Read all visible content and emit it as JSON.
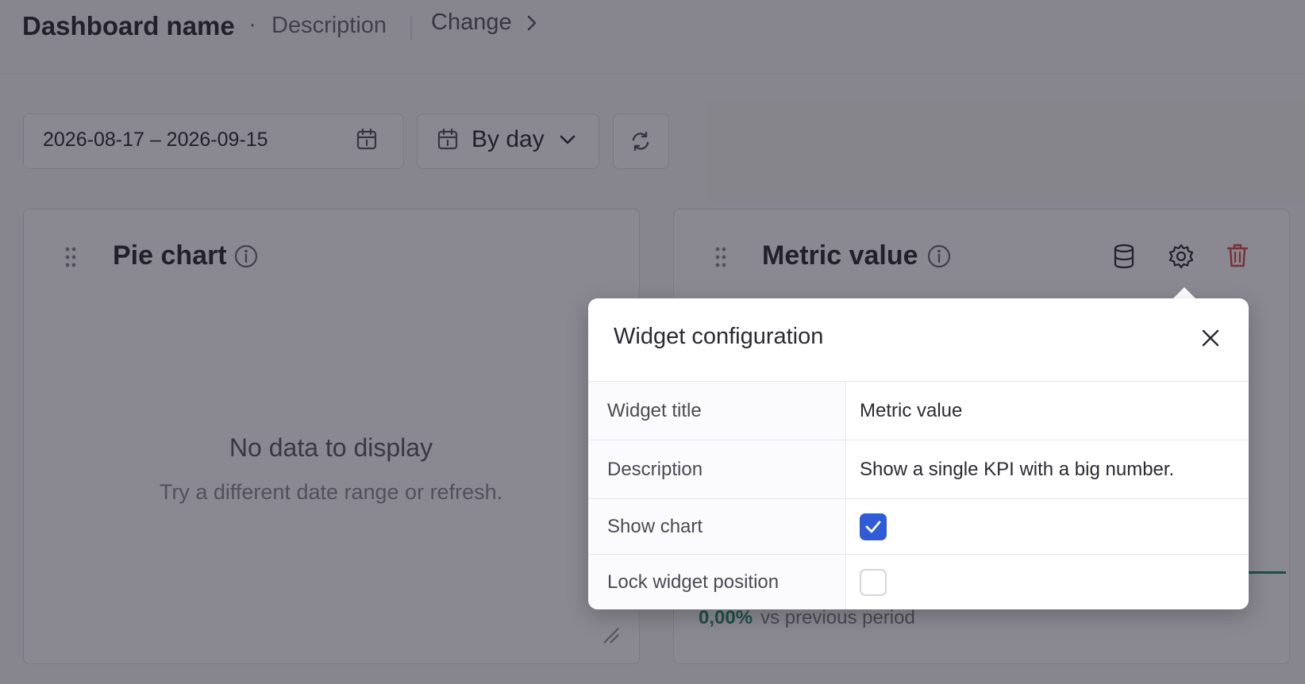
{
  "header": {
    "dashboard_name": "Dashboard name",
    "separator": "·",
    "description": "Description",
    "change_label": "Change"
  },
  "toolbar": {
    "date_range": "2026-08-17 – 2026-09-15",
    "group_by": "By day"
  },
  "widgets": {
    "pie": {
      "title": "Pie chart",
      "empty_title": "No data to display",
      "empty_subtitle": "Try a different date range or refresh."
    },
    "metric": {
      "title": "Metric value",
      "change_pct": "0,00%",
      "change_label": "vs previous period"
    }
  },
  "popover": {
    "title": "Widget configuration",
    "rows": [
      {
        "label": "Widget title",
        "value": "Metric value"
      },
      {
        "label": "Description",
        "value": "Show a single KPI with a big number."
      },
      {
        "label": "Show chart",
        "checked": true
      },
      {
        "label": "Lock widget position",
        "checked": false
      }
    ]
  },
  "colors": {
    "accent": "#2f5bd6",
    "danger": "#d94a4a",
    "positive": "#1f8a6b"
  }
}
